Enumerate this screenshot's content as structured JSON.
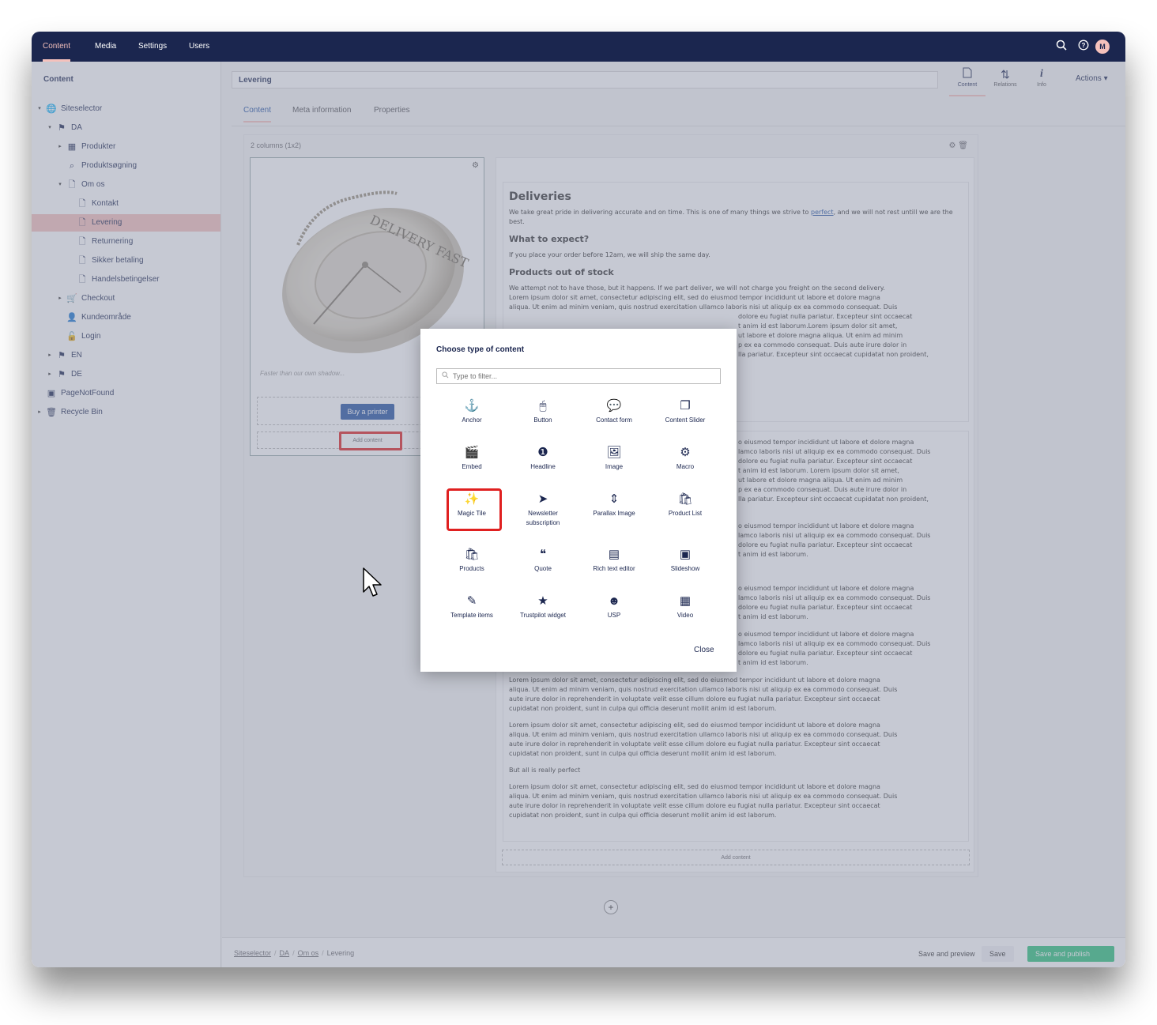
{
  "topnav": {
    "items": [
      "Content",
      "Media",
      "Settings",
      "Users"
    ],
    "active": "Content",
    "avatar": "M"
  },
  "sidebar": {
    "title": "Content",
    "tree": [
      {
        "label": "Siteselector",
        "icon": "globe-icon"
      },
      {
        "label": "DA",
        "icon": "flag-icon"
      },
      {
        "label": "Produkter",
        "icon": "grid-icon"
      },
      {
        "label": "Produktsøgning",
        "icon": "search-icon"
      },
      {
        "label": "Om os",
        "icon": "document-icon"
      },
      {
        "label": "Kontakt",
        "icon": "document-icon"
      },
      {
        "label": "Levering",
        "icon": "document-icon"
      },
      {
        "label": "Returnering",
        "icon": "document-icon"
      },
      {
        "label": "Sikker betaling",
        "icon": "document-icon"
      },
      {
        "label": "Handelsbetingelser",
        "icon": "document-icon"
      },
      {
        "label": "Checkout",
        "icon": "cart-icon"
      },
      {
        "label": "Kundeområde",
        "icon": "user-icon"
      },
      {
        "label": "Login",
        "icon": "lock-icon"
      },
      {
        "label": "EN",
        "icon": "flag-icon"
      },
      {
        "label": "DE",
        "icon": "flag-icon"
      },
      {
        "label": "PageNotFound",
        "icon": "box-icon"
      },
      {
        "label": "Recycle Bin",
        "icon": "trash-icon"
      }
    ],
    "selected": "Levering"
  },
  "editor": {
    "name": "Levering",
    "apps": [
      {
        "label": "Content",
        "icon": "document-icon"
      },
      {
        "label": "Relations",
        "icon": "relations-icon"
      },
      {
        "label": "Info",
        "icon": "info-icon"
      }
    ],
    "actions_label": "Actions ▾",
    "tabs": [
      "Content",
      "Meta information",
      "Properties"
    ],
    "active_tab": "Content",
    "grid_title": "2 columns (1x2)",
    "left": {
      "caption": "Faster than our own shadow...",
      "buy_button": "Buy a printer",
      "add_content": "Add content",
      "watch_text": "DELIVERY FAST"
    },
    "right": {
      "h1": "Deliveries",
      "p1_a": "We take great pride in delivering accurate and on time. This is one of many things we strive to ",
      "p1_link": "perfect",
      "p1_b": ", and we will not rest untill we are the best.",
      "h3_1": "What to expect?",
      "p2": "If you place your order before 12am, we will ship the same day.",
      "h3_2": "Products out of stock",
      "p3_line1": "We attempt not to have those, but it happens. If we part deliver, we will not charge you freight on the second delivery.",
      "p3_lines": [
        "Lorem ipsum dolor sit amet, consectetur adipiscing elit, sed do eiusmod tempor incididunt ut labore et dolore magna",
        "aliqua. Ut enim ad minim veniam, quis nostrud exercitation ullamco laboris nisi ut aliquip ex ea commodo consequat. Duis",
        "t anim id est laborum.Lorem ipsum dolor sit amet,",
        "ut labore et dolore magna aliqua. Ut enim ad minim",
        "p ex ea commodo consequat. Duis aute irure dolor in",
        "lla pariatur. Excepteur sint occaecat cupidatat non proident,"
      ],
      "p3_frag": "dolore eu fugiat nulla pariatur. Excepteur sint occaecat",
      "b2_frags": [
        "o eiusmod tempor incididunt ut labore et dolore magna",
        "lamco laboris nisi ut aliquip ex ea commodo consequat. Duis",
        "dolore eu fugiat nulla pariatur. Excepteur sint occaecat",
        "t anim id est laborum. Lorem ipsum dolor sit amet,",
        "ut labore et dolore magna aliqua. Ut enim ad minim",
        "p ex ea commodo consequat. Duis aute irure dolor in",
        "lla pariatur. Excepteur sint occaecat cupidatat non proident,"
      ],
      "b3_frags": [
        "o eiusmod tempor incididunt ut labore et dolore magna",
        "lamco laboris nisi ut aliquip ex ea commodo consequat. Duis",
        "dolore eu fugiat nulla pariatur. Excepteur sint occaecat",
        "t anim id est laborum."
      ],
      "b4_frags": [
        "o eiusmod tempor incididunt ut labore et dolore magna",
        "lamco laboris nisi ut aliquip ex ea commodo consequat. Duis",
        "dolore eu fugiat nulla pariatur. Excepteur sint occaecat",
        "t anim id est laborum."
      ],
      "b5_frags": [
        "o eiusmod tempor incididunt ut labore et dolore magna",
        "lamco laboris nisi ut aliquip ex ea commodo consequat. Duis",
        "dolore eu fugiat nulla pariatur. Excepteur sint occaecat",
        "t anim id est laborum."
      ],
      "lorem_full": [
        "Lorem ipsum dolor sit amet, consectetur adipiscing elit, sed do eiusmod tempor incididunt ut labore et dolore magna",
        "aliqua. Ut enim ad minim veniam, quis nostrud exercitation ullamco laboris nisi ut aliquip ex ea commodo consequat. Duis",
        "aute irure dolor in reprehenderit in voluptate velit esse cillum dolore eu fugiat nulla pariatur. Excepteur sint occaecat",
        "cupidatat non proident, sunt in culpa qui officia deserunt mollit anim id est laborum."
      ],
      "perfect_line": "But all is really perfect",
      "add_content": "Add content"
    },
    "breadcrumb": [
      "Siteselector",
      "DA",
      "Om os",
      "Levering"
    ],
    "save_preview": "Save and preview",
    "save": "Save",
    "save_publish": "Save and publish"
  },
  "modal": {
    "title": "Choose type of content",
    "filter_placeholder": "Type to filter...",
    "items": [
      {
        "label": "Anchor",
        "icon": "anchor-icon",
        "glyph": "⚓"
      },
      {
        "label": "Button",
        "icon": "mouse-icon",
        "glyph": "🖱"
      },
      {
        "label": "Contact form",
        "icon": "chat-icon",
        "glyph": "💬"
      },
      {
        "label": "Content Slider",
        "icon": "slides-icon",
        "glyph": "❐"
      },
      {
        "label": "Embed",
        "icon": "clapperboard-icon",
        "glyph": "🎬"
      },
      {
        "label": "Headline",
        "icon": "one-circle-icon",
        "glyph": "❶"
      },
      {
        "label": "Image",
        "icon": "picture-icon",
        "glyph": "🖼"
      },
      {
        "label": "Macro",
        "icon": "cogs-icon",
        "glyph": "⚙"
      },
      {
        "label": "Magic Tile",
        "icon": "magic-wand-icon",
        "glyph": "✨"
      },
      {
        "label": "Newsletter\nsubscription",
        "icon": "paper-plane-icon",
        "glyph": "➤"
      },
      {
        "label": "Parallax Image",
        "icon": "vertical-arrows-icon",
        "glyph": "⇕"
      },
      {
        "label": "Product List",
        "icon": "shopping-bag-icon",
        "glyph": "🛍"
      },
      {
        "label": "Products",
        "icon": "shopping-bag-icon",
        "glyph": "🛍"
      },
      {
        "label": "Quote",
        "icon": "quote-icon",
        "glyph": "❝"
      },
      {
        "label": "Rich text editor",
        "icon": "article-icon",
        "glyph": "▤"
      },
      {
        "label": "Slideshow",
        "icon": "photos-icon",
        "glyph": "▣"
      },
      {
        "label": "Template items",
        "icon": "edit-icon",
        "glyph": "✎"
      },
      {
        "label": "Trustpilot widget",
        "icon": "star-icon",
        "glyph": "★"
      },
      {
        "label": "USP",
        "icon": "smiley-icon",
        "glyph": "☻"
      },
      {
        "label": "Video",
        "icon": "film-icon",
        "glyph": "▦"
      }
    ],
    "close_label": "Close",
    "highlighted": "Magic Tile"
  },
  "colors": {
    "topbar": "#1b264f",
    "accent": "#f5c1bc",
    "publish": "#2bc37c",
    "highlight": "#e02020",
    "link": "#2152a3"
  }
}
